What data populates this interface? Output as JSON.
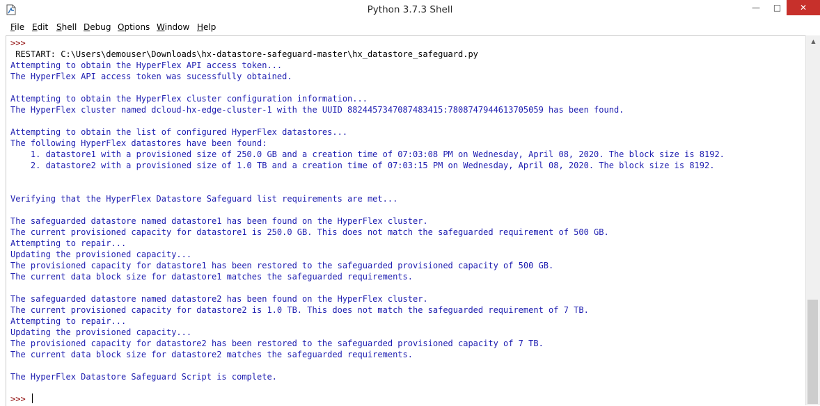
{
  "window": {
    "title": "Python 3.7.3 Shell"
  },
  "window_controls": {
    "minimize": "—",
    "maximize": "□",
    "close": "✕"
  },
  "menu": [
    {
      "underline": "F",
      "rest": "ile"
    },
    {
      "underline": "E",
      "rest": "dit"
    },
    {
      "underline": "S",
      "rest": "hell"
    },
    {
      "underline": "D",
      "rest": "ebug"
    },
    {
      "underline": "O",
      "rest": "ptions"
    },
    {
      "underline": "W",
      "rest": "indow"
    },
    {
      "underline": "H",
      "rest": "elp"
    }
  ],
  "shell": {
    "prompt": ">>>",
    "restart_line": " RESTART: C:\\Users\\demouser\\Downloads\\hx-datastore-safeguard-master\\hx_datastore_safeguard.py",
    "output_lines": [
      "Attempting to obtain the HyperFlex API access token...",
      "The HyperFlex API access token was sucessfully obtained.",
      "",
      "Attempting to obtain the HyperFlex cluster configuration information...",
      "The HyperFlex cluster named dcloud-hx-edge-cluster-1 with the UUID 8824457347087483415:7808747944613705059 has been found.",
      "",
      "Attempting to obtain the list of configured HyperFlex datastores...",
      "The following HyperFlex datastores have been found:",
      "    1. datastore1 with a provisioned size of 250.0 GB and a creation time of 07:03:08 PM on Wednesday, April 08, 2020. The block size is 8192.",
      "    2. datastore2 with a provisioned size of 1.0 TB and a creation time of 07:03:15 PM on Wednesday, April 08, 2020. The block size is 8192.",
      "",
      "",
      "Verifying that the HyperFlex Datastore Safeguard list requirements are met...",
      "",
      "The safeguarded datastore named datastore1 has been found on the HyperFlex cluster.",
      "The current provisioned capacity for datastore1 is 250.0 GB. This does not match the safeguarded requirement of 500 GB.",
      "Attempting to repair...",
      "Updating the provisioned capacity...",
      "The provisioned capacity for datastore1 has been restored to the safeguarded provisioned capacity of 500 GB.",
      "The current data block size for datastore1 matches the safeguarded requirements.",
      "",
      "The safeguarded datastore named datastore2 has been found on the HyperFlex cluster.",
      "The current provisioned capacity for datastore2 is 1.0 TB. This does not match the safeguarded requirement of 7 TB.",
      "Attempting to repair...",
      "Updating the provisioned capacity...",
      "The provisioned capacity for datastore2 has been restored to the safeguarded provisioned capacity of 7 TB.",
      "The current data block size for datastore2 matches the safeguarded requirements.",
      "",
      "The HyperFlex Datastore Safeguard Script is complete.",
      ""
    ]
  },
  "colors": {
    "prompt": "#8b0000",
    "stdout": "#1d1db0",
    "close": "#c7302b"
  }
}
